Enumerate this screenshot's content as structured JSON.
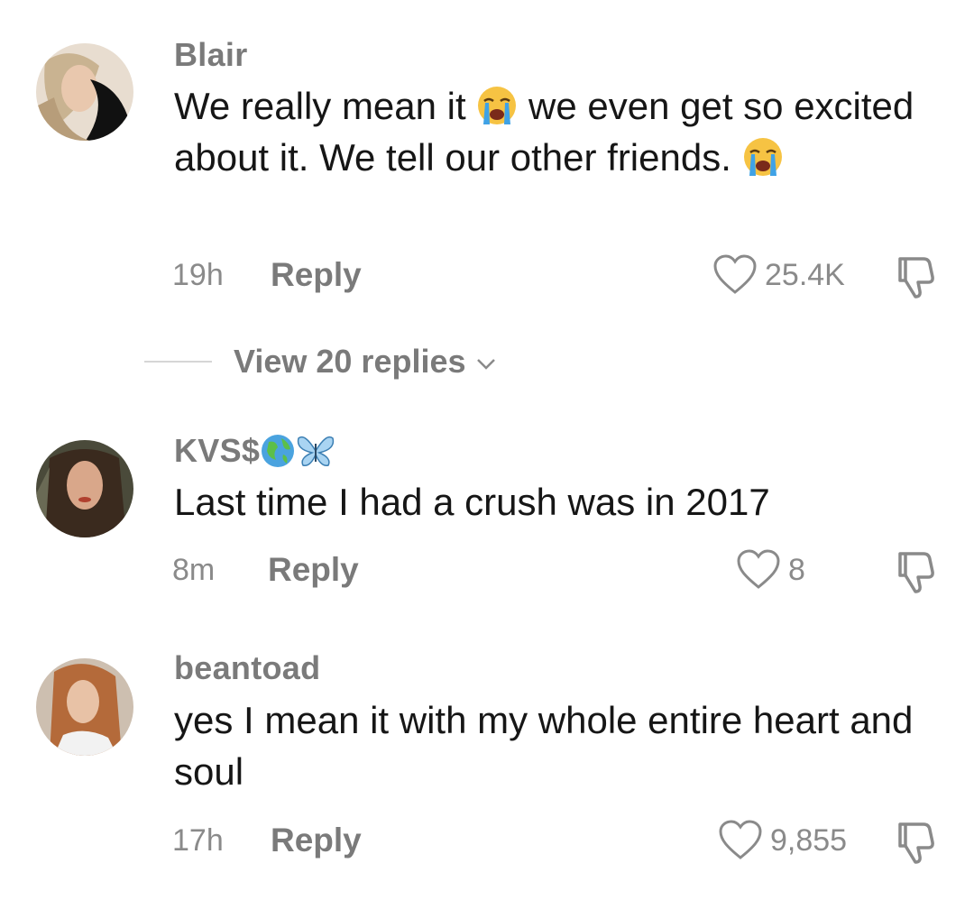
{
  "comments": [
    {
      "username": "Blair",
      "text_parts": [
        "We really mean it ",
        " we even get so excited about it. We tell our other friends. "
      ],
      "emoji": "loudly-crying-face",
      "time": "19h",
      "reply_label": "Reply",
      "likes": "25.4K"
    },
    {
      "username": "KVS$",
      "username_icons": [
        "globe-icon",
        "butterfly-icon"
      ],
      "text": "Last time I had a crush was in 2017",
      "time": "8m",
      "reply_label": "Reply",
      "likes": "8"
    },
    {
      "username": "beantoad",
      "text": "yes I mean it with my whole entire heart and soul",
      "time": "17h",
      "reply_label": "Reply",
      "likes": "9,855"
    }
  ],
  "view_replies_label": "View 20 replies",
  "colors": {
    "meta": "#8a8a8a",
    "text": "#161616",
    "divider": "#d6d6d6"
  }
}
